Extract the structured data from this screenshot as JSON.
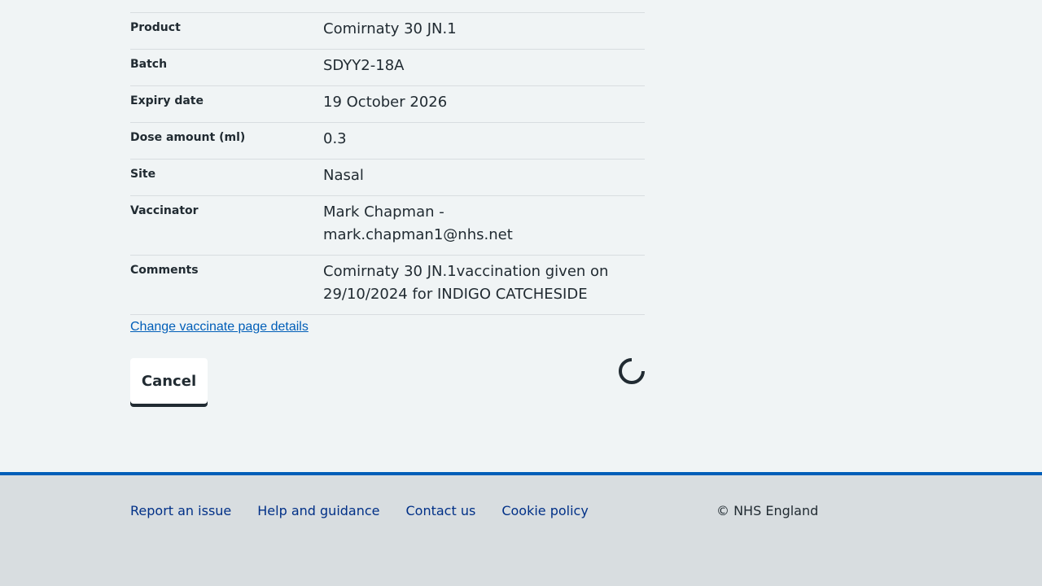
{
  "summary": {
    "rows": [
      {
        "key": "Product",
        "value": "Comirnaty 30 JN.1"
      },
      {
        "key": "Batch",
        "value": "SDYY2-18A"
      },
      {
        "key": "Expiry date",
        "value": "19 October 2026"
      },
      {
        "key": "Dose amount (ml)",
        "value": "0.3"
      },
      {
        "key": "Site",
        "value": "Nasal"
      },
      {
        "key": "Vaccinator",
        "value": "Mark Chapman - mark.chapman1@nhs.net"
      },
      {
        "key": "Comments",
        "value": "Comirnaty 30 JN.1vaccination given on 29/10/2024 for INDIGO CATCHESIDE"
      }
    ],
    "change_link": "Change vaccinate page details"
  },
  "actions": {
    "cancel_label": "Cancel",
    "loading_icon": "spinner-icon"
  },
  "footer": {
    "links": [
      "Report an issue",
      "Help and guidance",
      "Contact us",
      "Cookie policy"
    ],
    "copyright": "© NHS England"
  },
  "colors": {
    "background": "#f0f4f5",
    "link": "#005eb8",
    "footer_link": "#003087",
    "footer_bg": "#d8dde0",
    "footer_border": "#005eb8",
    "text": "#212b32"
  }
}
